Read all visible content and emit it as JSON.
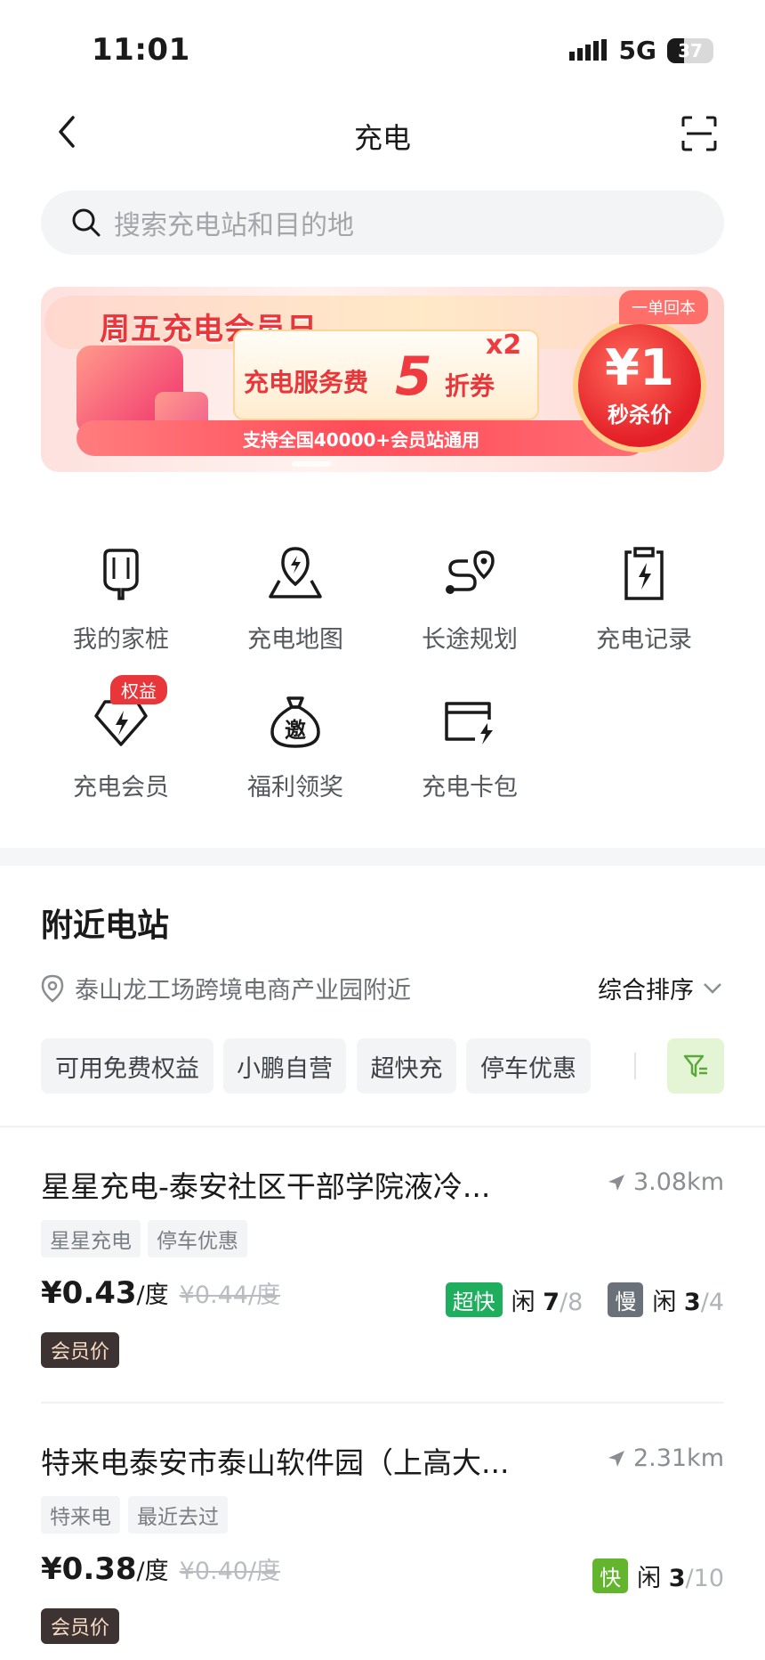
{
  "status_bar": {
    "time": "11:01",
    "network": "5G",
    "battery": "37"
  },
  "header": {
    "title": "充电"
  },
  "search": {
    "placeholder": "搜索充电站和目的地"
  },
  "banner": {
    "title": "周五充电会员日",
    "coupon_text": "充电服务费",
    "coupon_value": "5",
    "coupon_unit": "折券",
    "multiplier": "x2",
    "subtitle": "支持全国40000+会员站通用",
    "price": "¥1",
    "price_label": "秒杀价",
    "corner_tag": "一单回本"
  },
  "grid": [
    {
      "label": "我的家桩",
      "icon": "home-charger-icon"
    },
    {
      "label": "充电地图",
      "icon": "charging-map-icon"
    },
    {
      "label": "长途规划",
      "icon": "route-plan-icon"
    },
    {
      "label": "充电记录",
      "icon": "charging-record-icon"
    },
    {
      "label": "充电会员",
      "icon": "membership-icon",
      "badge": "权益"
    },
    {
      "label": "福利领奖",
      "icon": "reward-bag-icon"
    },
    {
      "label": "充电卡包",
      "icon": "card-wallet-icon"
    }
  ],
  "nearby": {
    "title": "附近电站",
    "location": "泰山龙工场跨境电商产业园附近",
    "sort": "综合排序",
    "filters": [
      "可用免费权益",
      "小鹏自营",
      "超快充",
      "停车优惠"
    ]
  },
  "stations": [
    {
      "name": "星星充电-泰安社区干部学院液冷...",
      "distance": "3.08km",
      "tags": [
        "星星充电",
        "停车优惠"
      ],
      "price": "¥0.43",
      "unit": "/度",
      "old_price": "¥0.44/度",
      "member": "会员价",
      "availability": [
        {
          "type": "超快",
          "color": "#1fae5e",
          "idle_label": "闲",
          "free": "7",
          "total": "/8"
        },
        {
          "type": "慢",
          "color": "#6b7178",
          "idle_label": "闲",
          "free": "3",
          "total": "/4"
        }
      ]
    },
    {
      "name": "特来电泰安市泰山软件园（上高大...",
      "distance": "2.31km",
      "tags": [
        "特来电",
        "最近去过"
      ],
      "price": "¥0.38",
      "unit": "/度",
      "old_price": "¥0.40/度",
      "member": "会员价",
      "availability": [
        {
          "type": "快",
          "color": "#62b52c",
          "idle_label": "闲",
          "free": "3",
          "total": "/10"
        }
      ]
    }
  ]
}
